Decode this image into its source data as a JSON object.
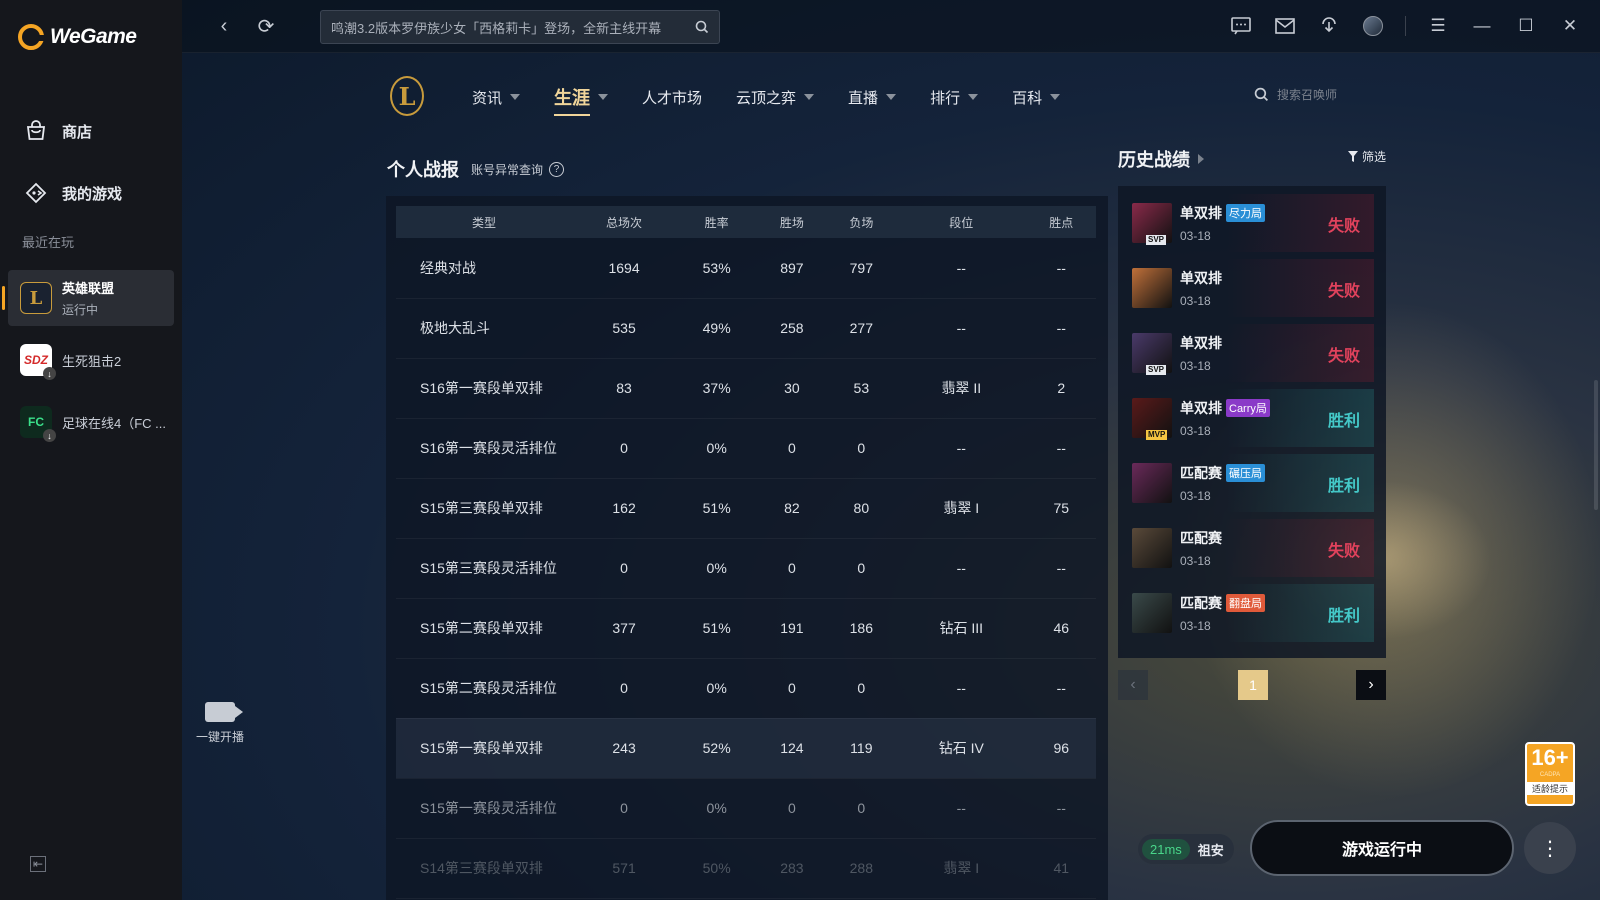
{
  "brand": {
    "name": "WeGame"
  },
  "sidebar": {
    "items": [
      {
        "label": "商店",
        "icon": "shop-bag-icon"
      },
      {
        "label": "我的游戏",
        "icon": "gamepad-icon"
      }
    ],
    "recent_label": "最近在玩",
    "recent": [
      {
        "name": "英雄联盟",
        "status": "运行中",
        "icon": "lol-icon",
        "active": true
      },
      {
        "name": "生死狙击2",
        "status": "",
        "icon": "sszj-icon",
        "active": false
      },
      {
        "name": "足球在线4（FC ...",
        "status": "",
        "icon": "fc-icon",
        "active": false
      }
    ]
  },
  "topbar": {
    "search_text": "鸣潮3.2版本罗伊族少女「西格莉卡」登场，全新主线开幕"
  },
  "lol": {
    "nav": [
      {
        "label": "资讯",
        "caret": true,
        "active": false
      },
      {
        "label": "生涯",
        "caret": true,
        "active": true
      },
      {
        "label": "人才市场",
        "caret": false,
        "active": false
      },
      {
        "label": "云顶之弈",
        "caret": true,
        "active": false
      },
      {
        "label": "直播",
        "caret": true,
        "active": false
      },
      {
        "label": "排行",
        "caret": true,
        "active": false
      },
      {
        "label": "百科",
        "caret": true,
        "active": false
      }
    ],
    "summoner_search_placeholder": "搜索召唤师"
  },
  "stats": {
    "title": "个人战报",
    "account_query": "账号异常查询",
    "columns": [
      "类型",
      "总场次",
      "胜率",
      "胜场",
      "负场",
      "段位",
      "胜点"
    ],
    "rows": [
      [
        "经典对战",
        "1694",
        "53%",
        "897",
        "797",
        "--",
        "--"
      ],
      [
        "极地大乱斗",
        "535",
        "49%",
        "258",
        "277",
        "--",
        "--"
      ],
      [
        "S16第一赛段单双排",
        "83",
        "37%",
        "30",
        "53",
        "翡翠 II",
        "2"
      ],
      [
        "S16第一赛段灵活排位",
        "0",
        "0%",
        "0",
        "0",
        "--",
        "--"
      ],
      [
        "S15第三赛段单双排",
        "162",
        "51%",
        "82",
        "80",
        "翡翠 I",
        "75"
      ],
      [
        "S15第三赛段灵活排位",
        "0",
        "0%",
        "0",
        "0",
        "--",
        "--"
      ],
      [
        "S15第二赛段单双排",
        "377",
        "51%",
        "191",
        "186",
        "钻石 III",
        "46"
      ],
      [
        "S15第二赛段灵活排位",
        "0",
        "0%",
        "0",
        "0",
        "--",
        "--"
      ],
      [
        "S15第一赛段单双排",
        "243",
        "52%",
        "124",
        "119",
        "钻石 IV",
        "96"
      ],
      [
        "S15第一赛段灵活排位",
        "0",
        "0%",
        "0",
        "0",
        "--",
        "--"
      ],
      [
        "S14第三赛段单双排",
        "571",
        "50%",
        "283",
        "288",
        "翡翠 I",
        "41"
      ]
    ]
  },
  "live": {
    "label": "一键开播"
  },
  "history": {
    "title": "历史战绩",
    "filter": "筛选",
    "matches": [
      {
        "mode": "单双排",
        "badge": "尽力局",
        "badge_color": "#2a8fd6",
        "date": "03-18",
        "result": "失败",
        "win": false,
        "tag": "SVP",
        "champ_color": "#8a2a4a"
      },
      {
        "mode": "单双排",
        "badge": "",
        "badge_color": "",
        "date": "03-18",
        "result": "失败",
        "win": false,
        "tag": "",
        "champ_color": "#c0703a"
      },
      {
        "mode": "单双排",
        "badge": "",
        "badge_color": "",
        "date": "03-18",
        "result": "失败",
        "win": false,
        "tag": "SVP",
        "champ_color": "#4a3a6a"
      },
      {
        "mode": "单双排",
        "badge": "Carry局",
        "badge_color": "#8a3ac8",
        "date": "03-18",
        "result": "胜利",
        "win": true,
        "tag": "MVP",
        "champ_color": "#5a1a1a"
      },
      {
        "mode": "匹配赛",
        "badge": "碾压局",
        "badge_color": "#2a8fd6",
        "date": "03-18",
        "result": "胜利",
        "win": true,
        "tag": "",
        "champ_color": "#6a2a5a"
      },
      {
        "mode": "匹配赛",
        "badge": "",
        "badge_color": "",
        "date": "03-18",
        "result": "失败",
        "win": false,
        "tag": "",
        "champ_color": "#5a4a3a"
      },
      {
        "mode": "匹配赛",
        "badge": "翻盘局",
        "badge_color": "#e05a3a",
        "date": "03-18",
        "result": "胜利",
        "win": true,
        "tag": "",
        "champ_color": "#3a4a4a"
      }
    ],
    "page": "1"
  },
  "age_rating": {
    "number": "16+",
    "org": "CADPA",
    "label": "适龄提示"
  },
  "bottom": {
    "ping": "21ms",
    "server": "祖安",
    "run_label": "游戏运行中"
  }
}
